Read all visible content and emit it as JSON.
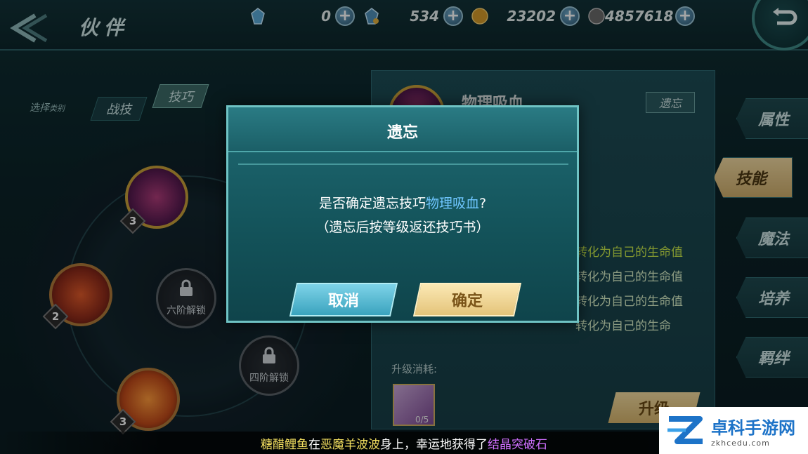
{
  "header": {
    "title": "伙伴"
  },
  "currencies": [
    {
      "icon": "crystal-icon",
      "value": "0"
    },
    {
      "icon": "locked-crystal-icon",
      "value": "534"
    },
    {
      "icon": "gold-coin-icon",
      "value": "23202"
    },
    {
      "icon": "silver-coin-icon",
      "value": "4857618"
    }
  ],
  "category": {
    "label": "选择",
    "label_small": "类别",
    "tabs": [
      "战技",
      "技巧"
    ]
  },
  "skills": [
    {
      "level": "3"
    },
    {
      "level": "2"
    },
    {
      "level": "3"
    }
  ],
  "locks": [
    "六阶解锁",
    "四阶解锁"
  ],
  "info": {
    "skill_name": "物理吸血",
    "forget_label": "遗忘",
    "desc_lines": [
      "转化为自己的生命值",
      "转化为自己的生命值",
      "转化为自己的生命值",
      "转化为自己的生命"
    ],
    "upgrade_cost_label": "升级消耗:",
    "book_count": "0/5",
    "upgrade_button": "升级"
  },
  "side_tabs": [
    "属性",
    "技能",
    "魔法",
    "培养",
    "羁绊"
  ],
  "modal": {
    "title": "遗忘",
    "question_prefix": "是否确定遗忘技巧",
    "question_skill": "物理吸血",
    "question_suffix": "?",
    "note": "（遗忘后按等级返还技巧书）",
    "cancel": "取消",
    "confirm": "确定"
  },
  "notice": {
    "player": "糖醋鲤鱼",
    "t1": "在",
    "monster": "恶魔羊波波",
    "t2": "身上，幸运地获得了",
    "item": "结晶突破石"
  },
  "watermark": {
    "name": "卓科手游网",
    "url": "zkhcedu.com"
  },
  "colors": {
    "highlight": "#6fc6ff",
    "accent_gold": "#e4c47a",
    "panel_teal": "#1f6a73"
  }
}
